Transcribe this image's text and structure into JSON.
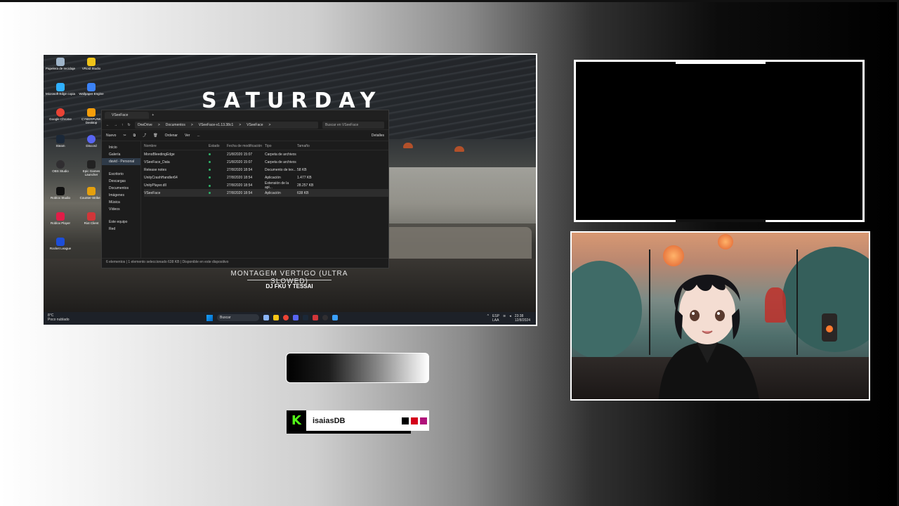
{
  "stream": {
    "channel_name": "isaiasDB",
    "kick_logo": "K",
    "accent_colors": [
      "#000000",
      "#d4001a",
      "#b0127a"
    ]
  },
  "capture": {
    "brand": "SATURDAY",
    "song_title": "MONTAGEM VERTIGO (ULTRA SLOWED)",
    "song_artist": "DJ FKU Y TESSAI",
    "desktop_icons": [
      {
        "label": "Papelera de reciclaje",
        "color": "#9fb4c9"
      },
      {
        "label": "VRoid Studio",
        "color": "#f0c419"
      },
      {
        "label": "Microsoft Edge copia",
        "color": "#2fb0ff"
      },
      {
        "label": "Wallpaper Engine",
        "color": "#3b82f6"
      },
      {
        "label": "Google Chrome",
        "color": "#ea4335"
      },
      {
        "label": "CYBERPUNK Desktop",
        "color": "#f59e0b"
      },
      {
        "label": "Steam",
        "color": "#1b2838"
      },
      {
        "label": "Discord",
        "color": "#5865f2"
      },
      {
        "label": "OBS Studio",
        "color": "#302e31"
      },
      {
        "label": "Epic Games Launcher",
        "color": "#222222"
      },
      {
        "label": "Roblox Studio",
        "color": "#111111"
      },
      {
        "label": "Counter-Strike 2",
        "color": "#e5a00d"
      },
      {
        "label": "Roblox Player",
        "color": "#e11d48"
      },
      {
        "label": "Riot Client",
        "color": "#d13639"
      },
      {
        "label": "Rocket League",
        "color": "#1d4ed8"
      }
    ],
    "explorer": {
      "tab_title": "VSeeFace",
      "breadcrumbs": [
        "OneDrive",
        ">",
        "Documentos",
        ">",
        "VSeeFace-v1.13.38c1",
        ">",
        "VSeeFace",
        ">"
      ],
      "search_placeholder": "Buscar en VSeeFace",
      "toolbar": [
        "Nuevo",
        "Ordenar",
        "Ver",
        "...",
        "Detalles"
      ],
      "nav": [
        "Inicio",
        "Galería",
        "david - Personal",
        "Escritorio",
        "Descargas",
        "Documentos",
        "Imágenes",
        "Música",
        "Vídeos",
        "Este equipo",
        "Red"
      ],
      "columns": [
        "Nombre",
        "Estado",
        "Fecha de modificación",
        "Tipo",
        "Tamaño"
      ],
      "files": [
        {
          "name": "MonoBleedingEdge",
          "date": "21/8/2020 15:07",
          "type": "Carpeta de archivos",
          "size": ""
        },
        {
          "name": "VSeeFace_Data",
          "date": "21/8/2020 15:07",
          "type": "Carpeta de archivos",
          "size": ""
        },
        {
          "name": "Release notes",
          "date": "27/8/2020 18:54",
          "type": "Documento de tex...",
          "size": "58 KB"
        },
        {
          "name": "UnityCrashHandler64",
          "date": "27/8/2020 18:54",
          "type": "Aplicación",
          "size": "1.477 KB"
        },
        {
          "name": "UnityPlayer.dll",
          "date": "27/8/2020 18:54",
          "type": "Extensión de la apl...",
          "size": "28.257 KB"
        },
        {
          "name": "VSeeFace",
          "date": "27/8/2020 18:54",
          "type": "Aplicación",
          "size": "638 KB"
        }
      ],
      "status": "6 elementos | 1 elemento seleccionado 638 KB | Disponible en este dispositivo"
    },
    "taskbar": {
      "weather": "8°C",
      "weather_desc": "Poco nublado",
      "search": "Buscar",
      "lang": "ESP",
      "lang2": "LAA",
      "time": "23:38",
      "date": "12/8/2024"
    }
  }
}
